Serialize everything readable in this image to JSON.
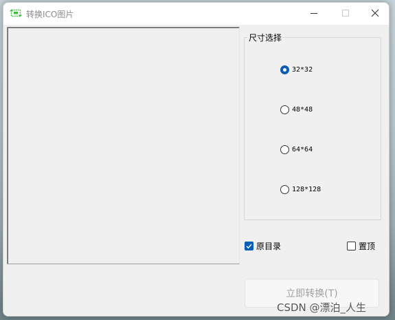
{
  "window": {
    "title": "转换ICO图片"
  },
  "size_group": {
    "title": "尺寸选择",
    "options": [
      {
        "label": "32*32",
        "selected": true
      },
      {
        "label": "48*48",
        "selected": false
      },
      {
        "label": "64*64",
        "selected": false
      },
      {
        "label": "128*128",
        "selected": false
      }
    ]
  },
  "options": {
    "original_dir_label": "原目录",
    "original_dir_checked": true,
    "pin_top_label": "置顶",
    "pin_top_checked": false
  },
  "convert_button": {
    "label": "立即转换(T)",
    "enabled": false
  },
  "watermark": "CSDN @漂泊_人生",
  "colors": {
    "accent": "#0a5fb4",
    "app_icon": "#3cc23c"
  }
}
